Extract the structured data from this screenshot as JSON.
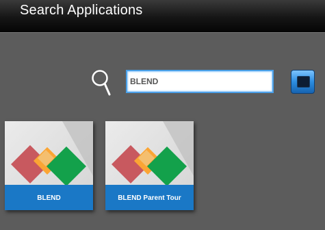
{
  "header": {
    "title": "Search Applications"
  },
  "search": {
    "value": "BLEND",
    "icon": "search-icon",
    "go_icon": "submit-icon"
  },
  "results": [
    {
      "label": "BLEND"
    },
    {
      "label": "BLEND Parent Tour"
    }
  ],
  "colors": {
    "background": "#5c5c5c",
    "tile_band": "#1a78c6",
    "input_border": "#4aa0e8",
    "logo_red": "#c8595f",
    "logo_orange": "#f7941d",
    "logo_green": "#13a14b"
  }
}
